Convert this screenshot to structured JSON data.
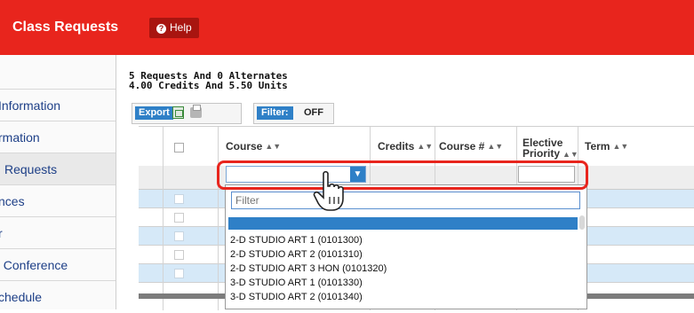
{
  "header": {
    "title": "Class Requests",
    "help_label": "Help"
  },
  "sidebar": {
    "items": [
      {
        "label": "Information"
      },
      {
        "label": "rmation"
      },
      {
        "label": "Requests"
      },
      {
        "label": "nces"
      },
      {
        "label": "r"
      },
      {
        "label": "t Conference"
      },
      {
        "label": "chedule"
      }
    ]
  },
  "summary": {
    "line1": "5 Requests And 0 Alternates",
    "line2": "4.00 Credits And 5.50 Units"
  },
  "toolbar": {
    "export_label": "Export",
    "filter_label": "Filter:",
    "filter_state": "OFF"
  },
  "table": {
    "headers": {
      "course": "Course",
      "credits": "Credits",
      "course_num": "Course #",
      "priority_line1": "Elective",
      "priority_line2": "Priority",
      "term": "Term"
    }
  },
  "dropdown": {
    "filter_placeholder": "Filter",
    "options": [
      "2-D STUDIO ART 1 (0101300)",
      "2-D STUDIO ART 2 (0101310)",
      "2-D STUDIO ART 3 HON (0101320)",
      "3-D STUDIO ART 1 (0101330)",
      "3-D STUDIO ART 2 (0101340)"
    ]
  },
  "colors": {
    "brand_red": "#e8251d",
    "accent_blue": "#2f80c7",
    "row_blue": "#d6e9f8"
  }
}
